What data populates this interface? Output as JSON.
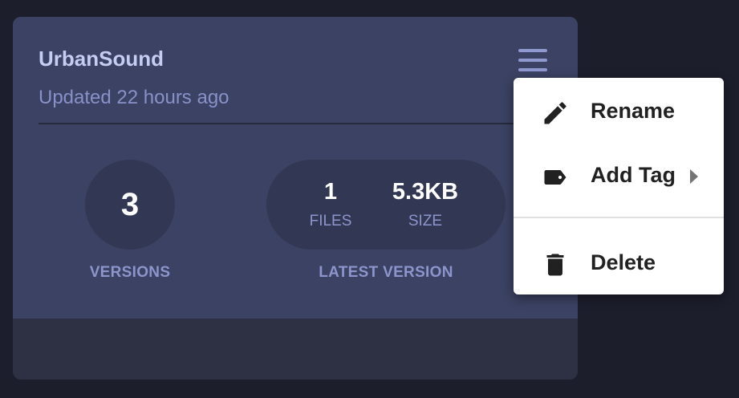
{
  "card": {
    "title": "UrbanSound",
    "updated": "Updated 22 hours ago",
    "versions": {
      "count": "3",
      "label": "VERSIONS"
    },
    "latest_version": {
      "files_value": "1",
      "files_label": "FILES",
      "size_value": "5.3KB",
      "size_label": "SIZE",
      "label": "LATEST VERSION"
    },
    "menu_icon": "hamburger-menu-icon"
  },
  "context_menu": {
    "items": [
      {
        "label": "Rename",
        "icon": "pencil-icon"
      },
      {
        "label": "Add Tag",
        "icon": "tag-icon",
        "has_submenu": true
      },
      {
        "label": "Delete",
        "icon": "trash-icon"
      }
    ]
  },
  "colors": {
    "background": "#1c1e2c",
    "card_top": "#3b4263",
    "card_bottom": "#2e3144",
    "title": "#c6cdf2",
    "muted": "#8c95cc",
    "stat_bubble": "#323853",
    "menu_bg": "#ffffff",
    "menu_text": "#212121"
  }
}
